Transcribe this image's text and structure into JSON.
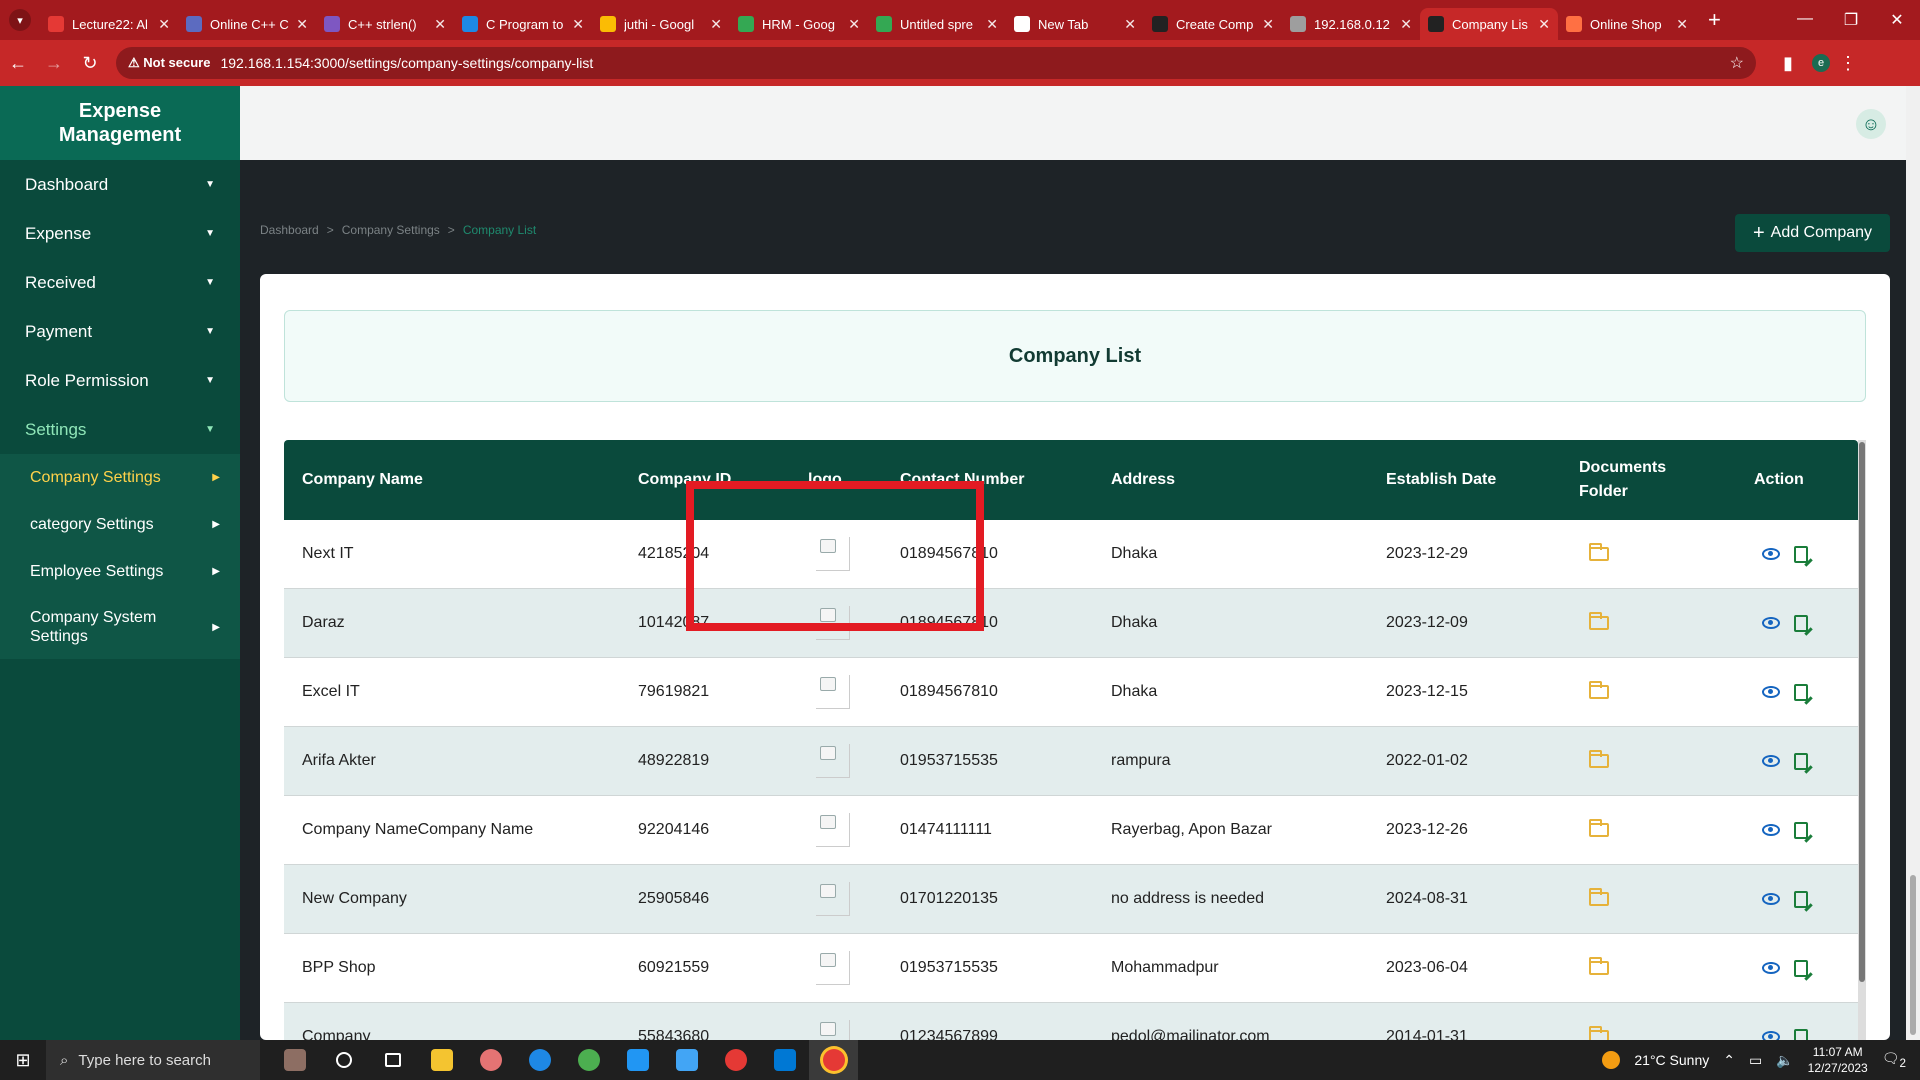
{
  "browser": {
    "tabs": [
      {
        "title": "Lecture22: Al",
        "color": "#e53935",
        "active": false
      },
      {
        "title": "Online C++ C",
        "color": "#5c6bc0",
        "active": false
      },
      {
        "title": "C++ strlen()",
        "color": "#7e57c2",
        "active": false
      },
      {
        "title": "C Program to",
        "color": "#1e88e5",
        "active": false
      },
      {
        "title": "juthi - Googl",
        "color": "#fbbc04",
        "active": false
      },
      {
        "title": "HRM - Goog",
        "color": "#34a853",
        "active": false
      },
      {
        "title": "Untitled spre",
        "color": "#34a853",
        "active": false
      },
      {
        "title": "New Tab",
        "color": "#ffffff",
        "active": false
      },
      {
        "title": "Create Comp",
        "color": "#222222",
        "active": false
      },
      {
        "title": "192.168.0.12",
        "color": "#9e9e9e",
        "active": false
      },
      {
        "title": "Company Lis",
        "color": "#222222",
        "active": true
      },
      {
        "title": "Online Shop",
        "color": "#ff7043",
        "active": false
      }
    ],
    "not_secure": "Not secure",
    "url": "192.168.1.154:3000/settings/company-settings/company-list",
    "profile_initial": "e"
  },
  "sidebar": {
    "brand": "Expense Management",
    "items": [
      {
        "label": "Dashboard"
      },
      {
        "label": "Expense"
      },
      {
        "label": "Received"
      },
      {
        "label": "Payment"
      },
      {
        "label": "Role Permission"
      },
      {
        "label": "Settings"
      }
    ],
    "sub_items": [
      {
        "label": "Company Settings"
      },
      {
        "label": "category Settings"
      },
      {
        "label": "Employee Settings"
      },
      {
        "label": "Company System Settings"
      }
    ]
  },
  "breadcrumb": {
    "home": "Dashboard",
    "parent": "Company Settings",
    "current": "Company List"
  },
  "add_button": "Add Company",
  "list_title": "Company List",
  "table": {
    "headers": [
      "Company Name",
      "Company ID",
      "logo",
      "Contact Number",
      "Address",
      "Establish Date",
      "Documents Folder",
      "Action"
    ],
    "rows": [
      {
        "name": "Next IT",
        "id": "42185204",
        "contact": "01894567810",
        "address": "Dhaka",
        "date": "2023-12-29"
      },
      {
        "name": "Daraz",
        "id": "10142087",
        "contact": "01894567810",
        "address": "Dhaka",
        "date": "2023-12-09"
      },
      {
        "name": "Excel IT",
        "id": "79619821",
        "contact": "01894567810",
        "address": "Dhaka",
        "date": "2023-12-15"
      },
      {
        "name": "Arifa Akter",
        "id": "48922819",
        "contact": "01953715535",
        "address": "rampura",
        "date": "2022-01-02"
      },
      {
        "name": "Company NameCompany Name",
        "id": "92204146",
        "contact": "01474111111",
        "address": "Rayerbag, Apon Bazar",
        "date": "2023-12-26"
      },
      {
        "name": "New Company",
        "id": "25905846",
        "contact": "01701220135",
        "address": "no address is needed",
        "date": "2024-08-31"
      },
      {
        "name": "BPP Shop",
        "id": "60921559",
        "contact": "01953715535",
        "address": "Mohammadpur",
        "date": "2023-06-04"
      },
      {
        "name": "Company",
        "id": "55843680",
        "contact": "01234567899",
        "address": "pedol@mailinator.com",
        "date": "2014-01-31"
      }
    ]
  },
  "taskbar": {
    "search_placeholder": "Type here to search",
    "weather": "21°C  Sunny",
    "time": "11:07 AM",
    "date": "12/27/2023",
    "notifications": "2"
  },
  "colors": {
    "sidebar": "#0a4a3c",
    "brand": "#0a6a55",
    "accent_active": "#ffd24a",
    "highlight": "#e31b23"
  }
}
